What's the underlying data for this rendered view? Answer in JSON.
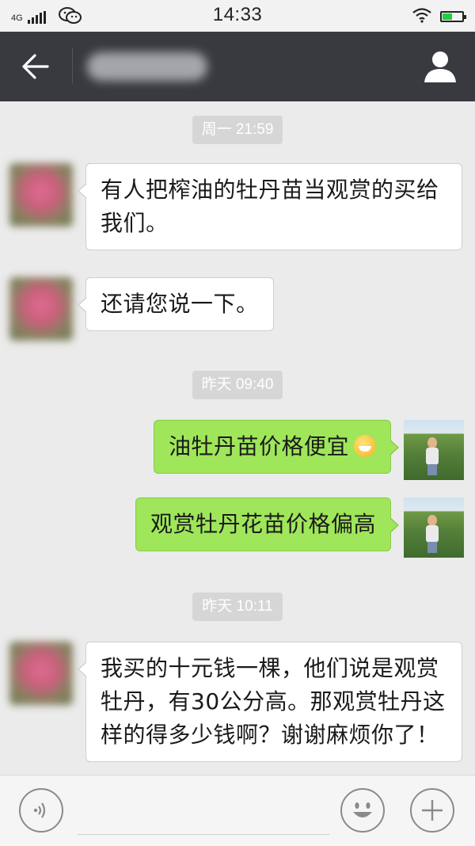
{
  "status_bar": {
    "network": "4G",
    "time": "14:33",
    "battery_level": 0.48
  },
  "title_bar": {
    "contact_name": "●●●●●●",
    "back_icon": "arrow-left-icon",
    "profile_icon": "person-icon"
  },
  "messages": [
    {
      "type": "timestamp",
      "text": "周一 21:59"
    },
    {
      "type": "message",
      "side": "left",
      "text": "有人把榨油的牡丹苗当观赏的买给我们。"
    },
    {
      "type": "message",
      "side": "left",
      "text": "还请您说一下。"
    },
    {
      "type": "timestamp",
      "text": "昨天 09:40"
    },
    {
      "type": "message",
      "side": "right",
      "text": "油牡丹苗价格便宜",
      "emoji": "grinning-face-emoji"
    },
    {
      "type": "message",
      "side": "right",
      "text": "观赏牡丹花苗价格偏高"
    },
    {
      "type": "timestamp",
      "text": "昨天 10:11"
    },
    {
      "type": "message",
      "side": "left",
      "text": "我买的十元钱一棵，他们说是观赏牡丹，有30公分高。那观赏牡丹这样的得多少钱啊？谢谢麻烦你了！"
    }
  ],
  "input_bar": {
    "placeholder": "",
    "voice_icon": "voice-icon",
    "emoji_icon": "smiley-icon",
    "plus_icon": "plus-icon"
  },
  "colors": {
    "title_bar_bg": "#393a3f",
    "chat_bg": "#ebebeb",
    "outgoing_bubble": "#9fe65a",
    "incoming_bubble": "#ffffff",
    "timestamp_bg": "#d6d6d6"
  }
}
